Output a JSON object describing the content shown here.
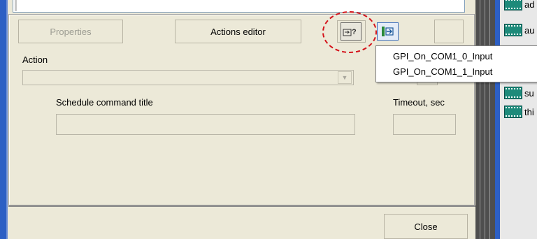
{
  "toolbar": {
    "properties_label": "Properties",
    "actions_editor_label": "Actions editor",
    "test_icon": "test-actions-icon",
    "gpi_icon": "gpi-input-icon"
  },
  "form": {
    "action_label": "Action",
    "action_value": "",
    "schedule_label": "Schedule command title",
    "schedule_value": "",
    "timeout_label": "Timeout, sec",
    "timeout_value": ""
  },
  "menu": {
    "items": [
      {
        "label": "GPI_On_COM1_0_Input"
      },
      {
        "label": "GPI_On_COM1_1_Input"
      }
    ]
  },
  "footer": {
    "close_label": "Close"
  },
  "right_pane": {
    "items": [
      {
        "label": "ad"
      },
      {
        "label": "au"
      },
      {
        "label": "su"
      },
      {
        "label": "thi"
      }
    ]
  },
  "colors": {
    "highlight_circle": "#d4131b",
    "window_frame": "#2d5fc4",
    "dialog_bg": "#ece9d8"
  }
}
